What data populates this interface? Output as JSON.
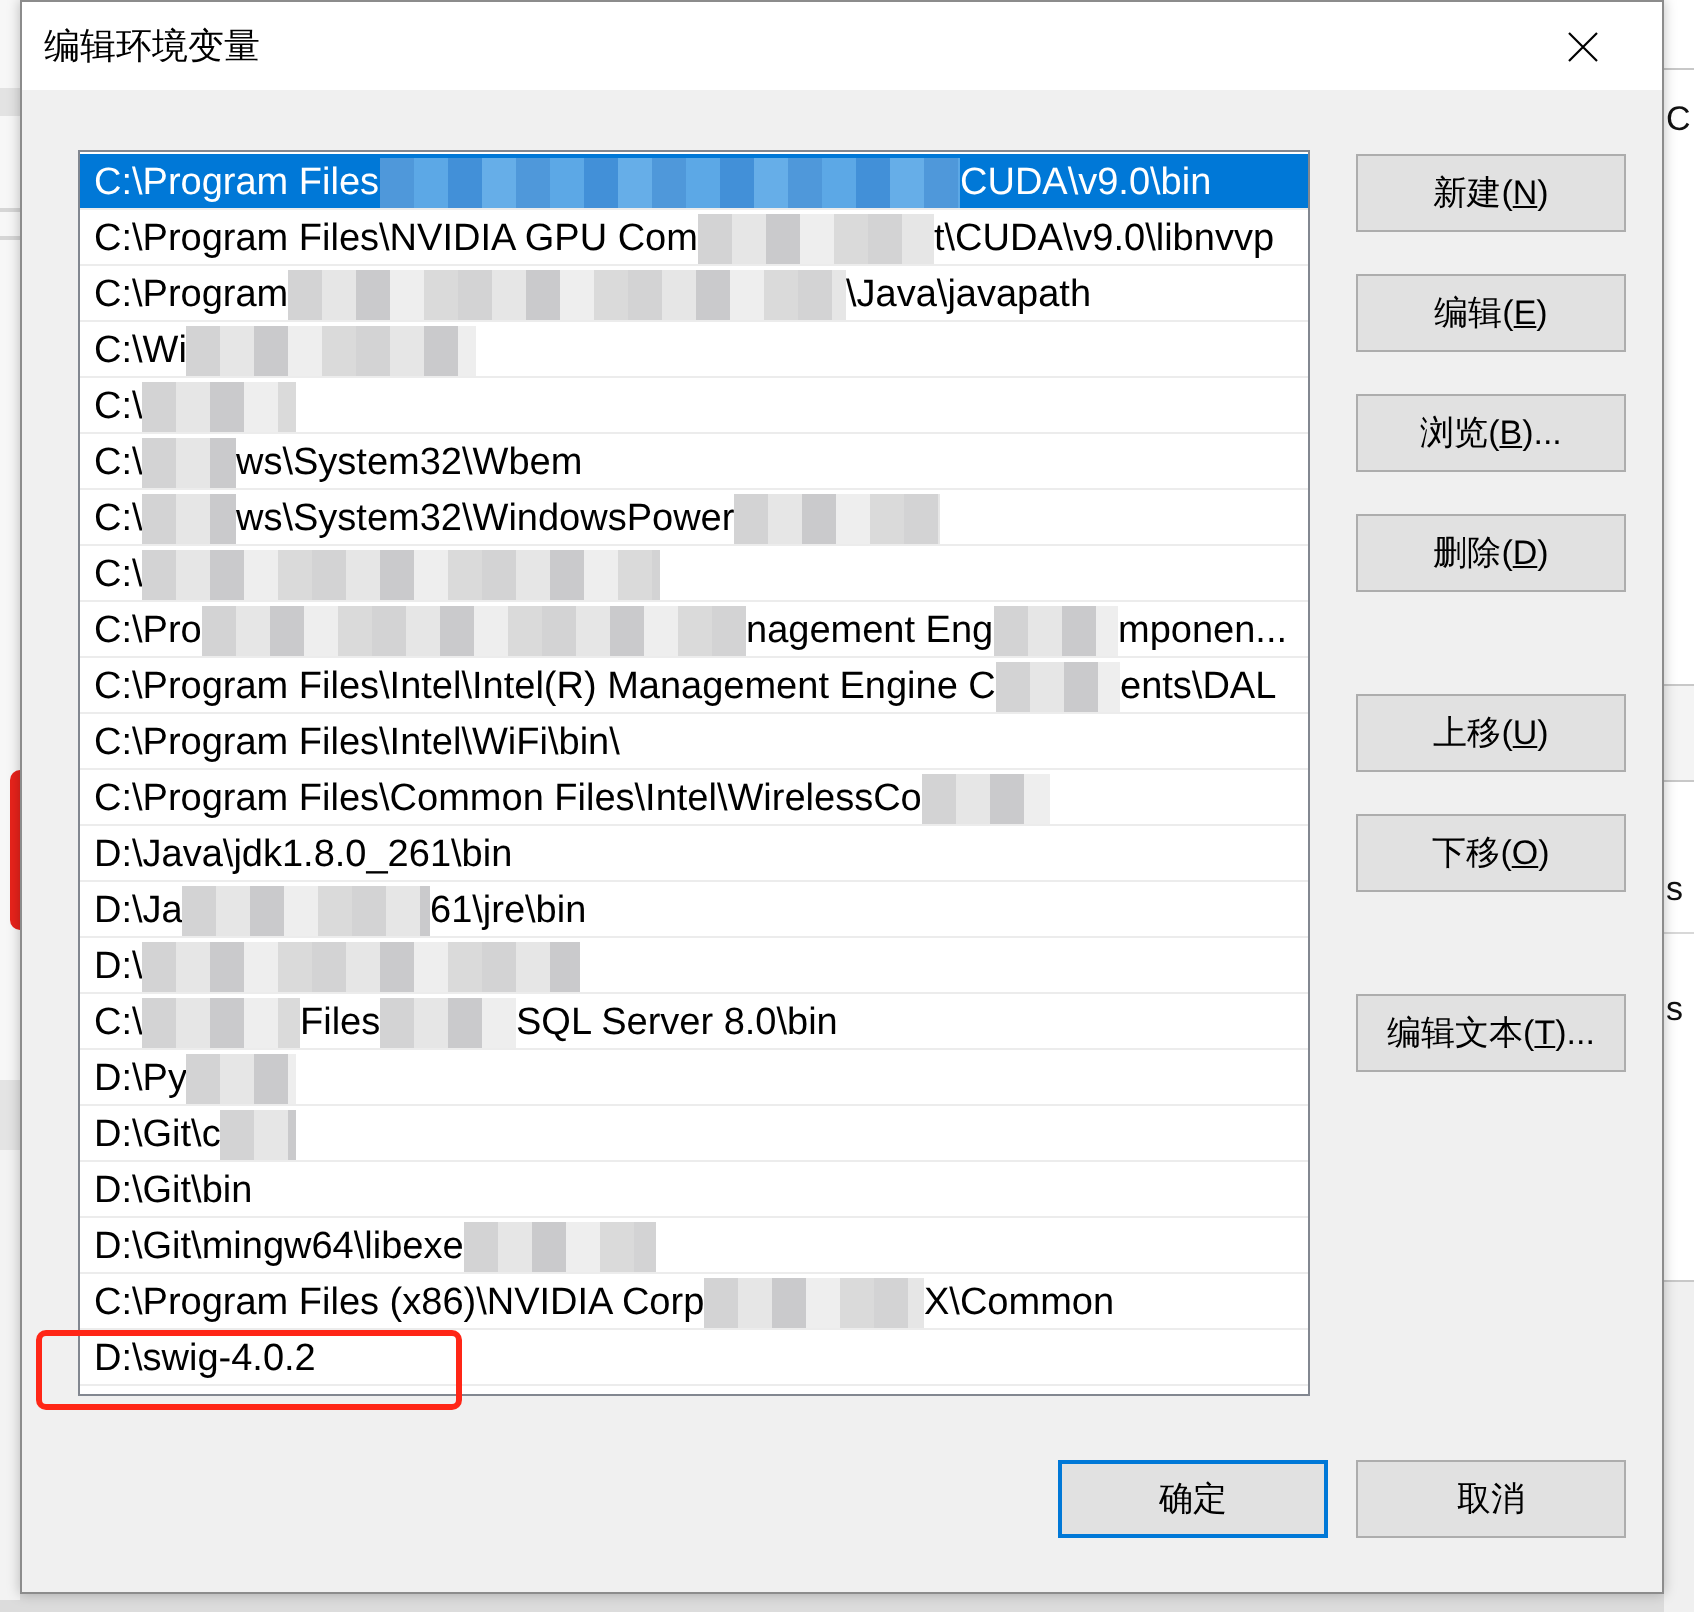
{
  "window": {
    "title": "编辑环境变量"
  },
  "path_list": {
    "items": [
      {
        "segments": [
          "C:\\Program Files",
          "CUDA\\v9.0\\bin"
        ],
        "selected": true,
        "highlighted": false
      },
      {
        "segments": [
          "C:\\Program Files\\NVIDIA GPU Com",
          "t\\CUDA\\v9.0\\libnvvp"
        ],
        "selected": false,
        "highlighted": false
      },
      {
        "segments": [
          "C:\\Program",
          "\\Java\\javapath"
        ],
        "selected": false,
        "highlighted": false
      },
      {
        "segments": [
          "C:\\Wi"
        ],
        "selected": false,
        "highlighted": false
      },
      {
        "segments": [
          "C:\\"
        ],
        "selected": false,
        "highlighted": false
      },
      {
        "segments": [
          "C:\\",
          "ws\\System32\\Wbem"
        ],
        "selected": false,
        "highlighted": false
      },
      {
        "segments": [
          "C:\\",
          "ws\\System32\\WindowsPower"
        ],
        "selected": false,
        "highlighted": false
      },
      {
        "segments": [
          "C:\\"
        ],
        "selected": false,
        "highlighted": false
      },
      {
        "segments": [
          "C:\\Pro",
          "nagement Eng",
          "mponen..."
        ],
        "selected": false,
        "highlighted": false
      },
      {
        "segments": [
          "C:\\Program Files\\Intel\\Intel(R) Management Engine C",
          "ents\\DAL"
        ],
        "selected": false,
        "highlighted": false
      },
      {
        "segments": [
          "C:\\Program Files\\Intel\\WiFi\\bin\\"
        ],
        "selected": false,
        "highlighted": false
      },
      {
        "segments": [
          "C:\\Program Files\\Common Files\\Intel\\WirelessCo"
        ],
        "selected": false,
        "highlighted": false
      },
      {
        "segments": [
          "D:\\Java\\jdk1.8.0_261\\bin"
        ],
        "selected": false,
        "highlighted": false
      },
      {
        "segments": [
          "D:\\Ja",
          "61\\jre\\bin"
        ],
        "selected": false,
        "highlighted": false
      },
      {
        "segments": [
          "D:\\"
        ],
        "selected": false,
        "highlighted": false
      },
      {
        "segments": [
          "C:\\",
          "Files",
          "SQL Server 8.0\\bin"
        ],
        "selected": false,
        "highlighted": false
      },
      {
        "segments": [
          "D:\\Py"
        ],
        "selected": false,
        "highlighted": false
      },
      {
        "segments": [
          "D:\\Git\\c"
        ],
        "selected": false,
        "highlighted": false
      },
      {
        "segments": [
          "D:\\Git\\bin"
        ],
        "selected": false,
        "highlighted": false
      },
      {
        "segments": [
          "D:\\Git\\mingw64\\libexe"
        ],
        "selected": false,
        "highlighted": false
      },
      {
        "segments": [
          "C:\\Program Files (x86)\\NVIDIA Corp",
          "X\\Common"
        ],
        "selected": false,
        "highlighted": false
      },
      {
        "segments": [
          "D:\\swig-4.0.2"
        ],
        "selected": false,
        "highlighted": true
      }
    ]
  },
  "button_groups": [
    {
      "buttons": [
        {
          "label_start": "新建(",
          "access_key": "N",
          "label_end": ")"
        },
        {
          "label_start": "编辑(",
          "access_key": "E",
          "label_end": ")"
        },
        {
          "label_start": "浏览(",
          "access_key": "B",
          "label_end": ")..."
        },
        {
          "label_start": "删除(",
          "access_key": "D",
          "label_end": ")"
        }
      ]
    },
    {
      "buttons": [
        {
          "label_start": "上移(",
          "access_key": "U",
          "label_end": ")"
        },
        {
          "label_start": "下移(",
          "access_key": "O",
          "label_end": ")"
        }
      ]
    },
    {
      "buttons": [
        {
          "label_start": "编辑文本(",
          "access_key": "T",
          "label_end": ")..."
        }
      ]
    }
  ],
  "footer_buttons": [
    {
      "label": "确定",
      "default": true
    },
    {
      "label": "取消",
      "default": false
    }
  ],
  "background_window": {
    "texts": [
      "C",
      "s",
      "s"
    ]
  }
}
